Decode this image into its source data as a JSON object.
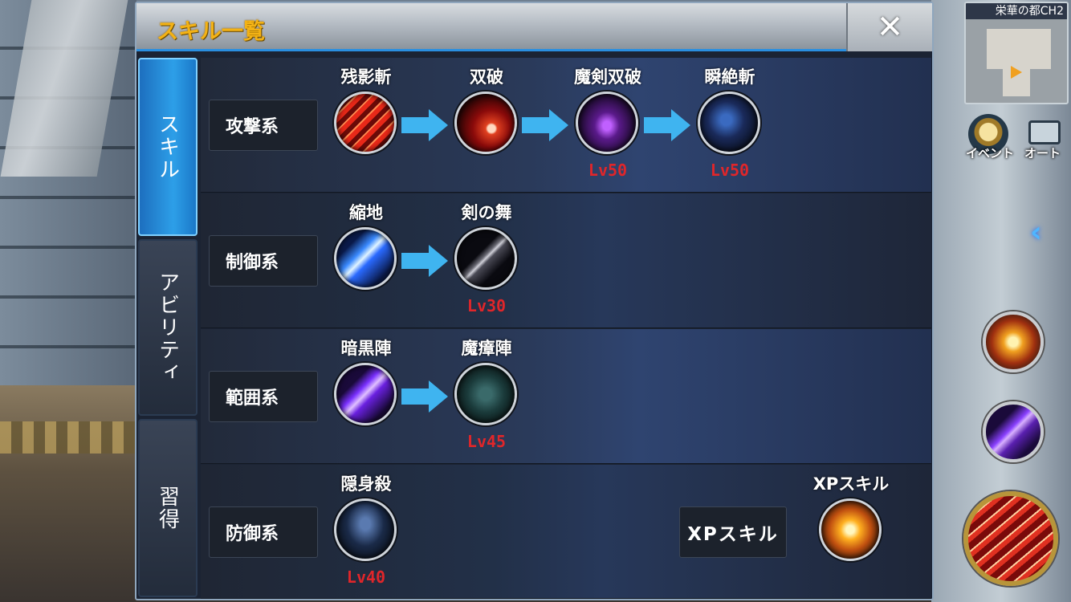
{
  "window": {
    "title": "スキル一覧",
    "close_label": "✕"
  },
  "tabs": [
    {
      "label": "スキル",
      "active": true
    },
    {
      "label": "アビリティ",
      "active": false
    },
    {
      "label": "習得",
      "active": false
    }
  ],
  "categories": [
    {
      "label": "攻撃系",
      "skills": [
        {
          "name": "残影斬",
          "level": "",
          "icon": "red-slash-skill-icon"
        },
        {
          "name": "双破",
          "level": "",
          "icon": "crimson-crescent-skill-icon"
        },
        {
          "name": "魔剣双破",
          "level": "Lv50",
          "icon": "purple-blade-skill-icon"
        },
        {
          "name": "瞬絶斬",
          "level": "Lv50",
          "icon": "dark-blue-claw-skill-icon"
        }
      ]
    },
    {
      "label": "制御系",
      "skills": [
        {
          "name": "縮地",
          "level": "",
          "icon": "blue-dagger-skill-icon"
        },
        {
          "name": "剣の舞",
          "level": "Lv30",
          "icon": "dark-sword-skill-icon"
        }
      ]
    },
    {
      "label": "範囲系",
      "skills": [
        {
          "name": "暗黒陣",
          "level": "",
          "icon": "violet-spear-skill-icon"
        },
        {
          "name": "魔瘴陣",
          "level": "Lv45",
          "icon": "teal-miasma-skill-icon"
        }
      ]
    },
    {
      "label": "防御系",
      "skills": [
        {
          "name": "隠身殺",
          "level": "Lv40",
          "icon": "hooded-figure-skill-icon"
        }
      ],
      "xp": {
        "box_label": "XPスキル",
        "skill_name": "XPスキル",
        "icon": "orange-burst-skill-icon"
      }
    }
  ],
  "hud": {
    "minimap_title": "栄華の都CH2",
    "event_label": "イベント",
    "auto_label": "オート"
  },
  "colors": {
    "title": "#f3b215",
    "accent": "#2a8fe0",
    "level_text": "#e0262a",
    "arrow": "#3fb4f0"
  }
}
